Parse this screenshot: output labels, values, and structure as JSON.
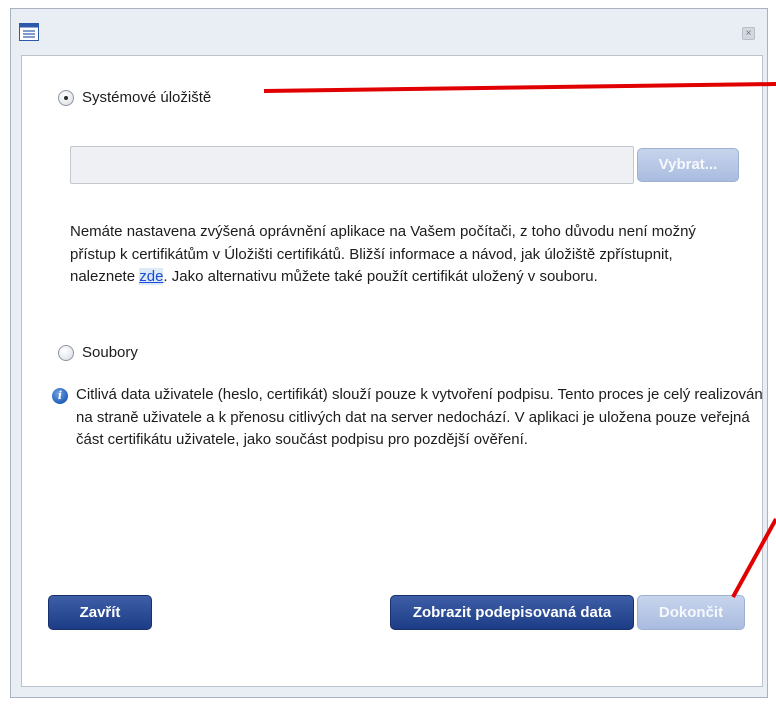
{
  "dialog": {
    "close_glyph": "×"
  },
  "source": {
    "system_option_label": "Systémové úložiště",
    "file_input_value": "",
    "select_button_label": "Vybrat...",
    "warning_text_before_link": "Nemáte nastavena zvýšená oprávnění aplikace na Vašem počítači, z toho důvodu není možný přístup k certifikátům v Úložišti certifikátů. Bližší informace a návod, jak úložiště zpřístupnit, naleznete ",
    "warning_link_text": "zde",
    "warning_text_after_link": ". Jako alternativu můžete také použít certifikát uložený v souboru.",
    "files_option_label": "Soubory",
    "info_text": "Citlivá data uživatele (heslo, certifikát) slouží pouze k vytvoření podpisu. Tento proces je celý realizován na straně uživatele a k přenosu citlivých dat na server nedochází. V aplikaci je uložena pouze veřejná část certifikátu uživatele, jako součást podpisu pro pozdější ověření.",
    "selected_option": "system"
  },
  "footer": {
    "close_button_label": "Zavřít",
    "show_data_button_label": "Zobrazit podepisovaná data",
    "finish_button_label": "Dokončit",
    "finish_enabled": false
  },
  "colors": {
    "primary_button": "#1d3d86",
    "disabled_button": "#a9bce0",
    "annotation_arrow": "#e00000",
    "link": "#1b4bd8"
  }
}
